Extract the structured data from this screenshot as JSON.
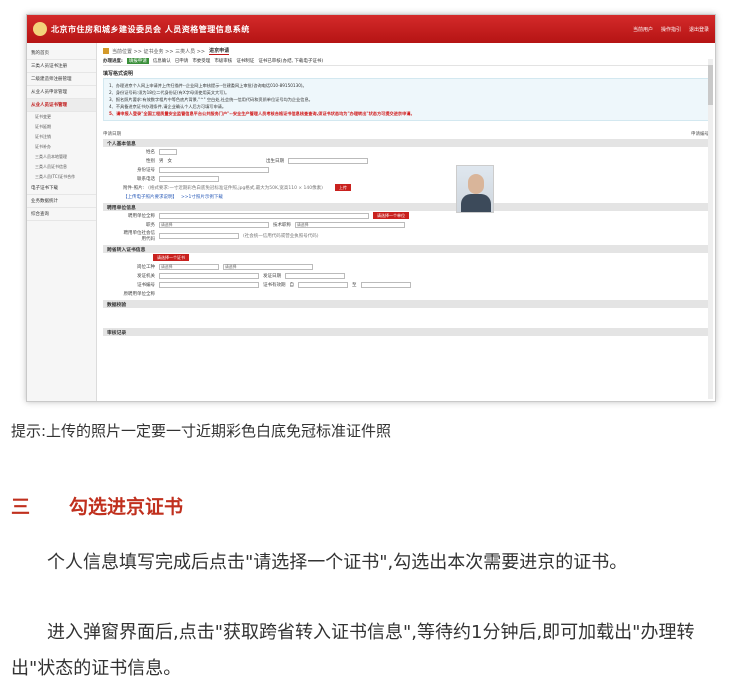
{
  "screenshot": {
    "system_title": "北京市住房和城乡建设委员会  人员资格管理信息系统",
    "top_links": [
      "当前用户",
      "操作指引",
      "退出登录"
    ],
    "sidebar": [
      "我的首页",
      "三类人员证书注册",
      "二级建造师注册管理",
      "从业人员申诉管理",
      "从业人员证书管理",
      "证书变更",
      "证书延期",
      "证书注销",
      "证书补办",
      "三类人员本地管理",
      "三类人员证书信息",
      "三类人员(TC)证书合作",
      "电子证书下载",
      "业务数据统计",
      "综合查询"
    ],
    "breadcrumb": {
      "text": "当前位置 >> 证书业务 >> 三类人员 >>",
      "current": "进京申请"
    },
    "steps": {
      "label": "办理进度:",
      "items": [
        "填报申请",
        "信息确认",
        "已申请",
        "市委受理",
        "市级审核",
        "证书制证",
        "证书已审核(办结, 下载电子证书)"
      ]
    },
    "notice_title": "填写格式说明",
    "notice_lines": [
      "1、办理进京个人网上申请并上传扫描件--企业网上审核提示--住建委网上审批(咨询电话010-89150130)。",
      "2、身份证号码:须为18位二代身份证(有X字母须使用英文大写)。",
      "3、报名照片要求:有效数字相片中等色底片背景,\"^\" 空白处,社会统一信用代码和资质单位证号均为企业信息。",
      "4、不具备进京证书办理条件,请企业确认个人后方可填写申请。"
    ],
    "notice_red": "5、请申报人登录\"全国工程质量安全监管信息平台公共服务门户\"--安全生产管理人员考核合格证书信息核查查询,须证书状态均为\"办理转出\"状态方可提交进京申请。",
    "form_title": "申请日期",
    "form_status": "申请编号",
    "sections": {
      "personal": "个人基本信息",
      "employ": "聘用单位信息",
      "cross": "跨省转入证书信息",
      "verify": "数据校验",
      "record": "审核记录"
    },
    "personal_fields": {
      "name_label": "姓名",
      "gender_label": "性别",
      "gender_options": [
        "男",
        "女"
      ],
      "birth_label": "出生日期",
      "idno_label": "身份证号",
      "phone_label": "联系电话",
      "attach_label": "附件-照片:",
      "attach_hint": "(格式要求:一寸近期彩色白底免冠标准证件照,jpg格式,最大为50K,宽高110 × 140像素)",
      "upload_label": "上传",
      "links": [
        "【上传电子照片要求说明】",
        ">>1寸照片示例下载"
      ]
    },
    "employ_fields": {
      "org_label": "聘用单位全称",
      "pick_btn": "请选择一个单位",
      "job_label": "职务",
      "job_value": "请选择",
      "title_label": "技术职称",
      "title_value": "请选择",
      "credit_label": "聘用单位社会信用代码",
      "credit_hint": "(社会统一信用代码或营业执照号代码)"
    },
    "cross_fields": {
      "get_btn": "请选择一个证书",
      "cat_label": "岗位工种",
      "cat_value": "请选择",
      "cat_value2": "请选择",
      "issuer_label": "发证机关",
      "issue_date_label": "发证日期",
      "cert_no_label": "证书编号",
      "valid_label": "证书有效期",
      "valid_from": "自",
      "valid_to": "至",
      "orig_org_label": "原聘用单位全称"
    },
    "colors": {
      "brand_red": "#c01818",
      "link_blue": "#2a5bb8",
      "notice_bg": "#eef7fb"
    }
  },
  "caption": "提示:上传的照片一定要一寸近期彩色白底免冠标准证件照",
  "section": {
    "number": "三",
    "title": "勾选进京证书"
  },
  "paragraphs": [
    "个人信息填写完成后点击\"请选择一个证书\",勾选出本次需要进京的证书。",
    "进入弹窗界面后,点击\"获取跨省转入证书信息\",等待约1分钟后,即可加载出\"办理转出\"状态的证书信息。"
  ]
}
